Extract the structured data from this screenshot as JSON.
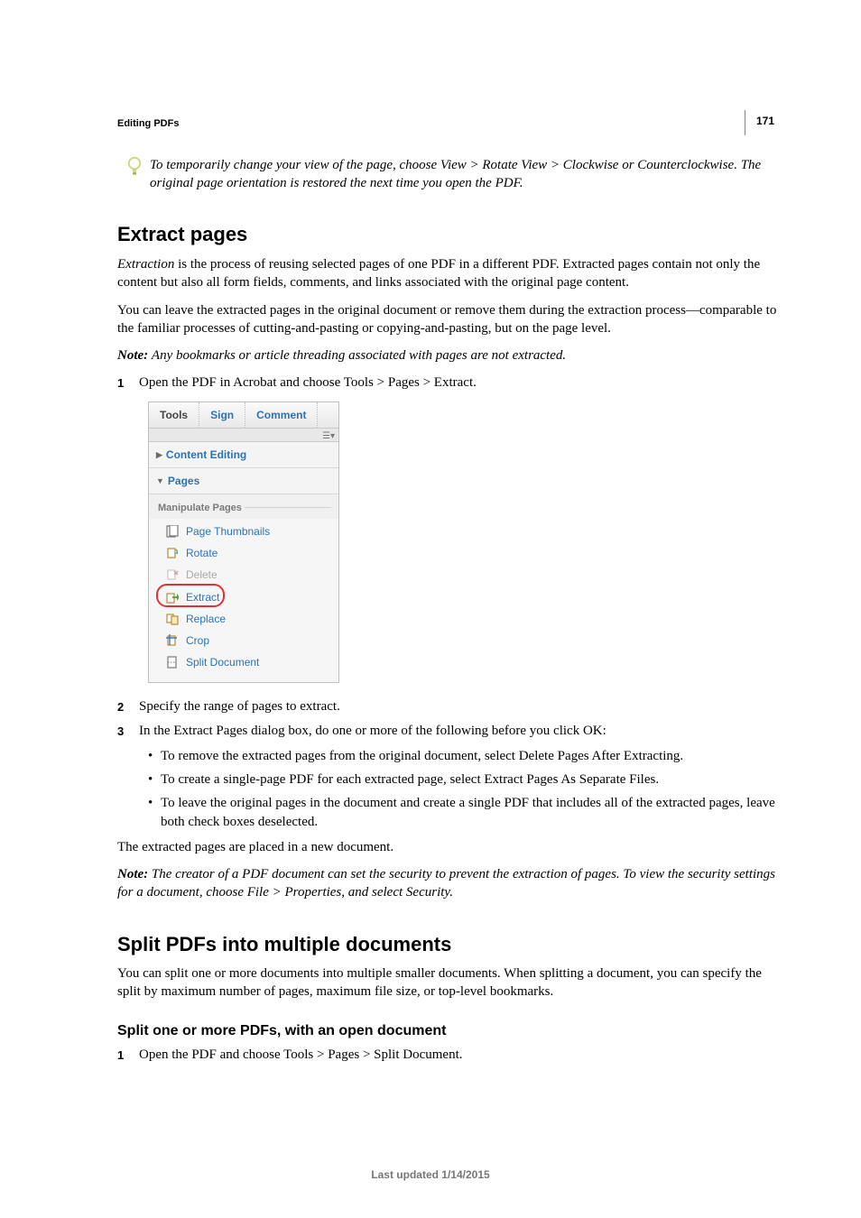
{
  "page_number": "171",
  "section_header": "Editing PDFs",
  "tip": "To temporarily change your view of the page, choose View > Rotate View > Clockwise or Counterclockwise. The original page orientation is restored the next time you open the PDF.",
  "h_extract": "Extract pages",
  "extract_p1_term": "Extraction",
  "extract_p1_rest": " is the process of reusing selected pages of one PDF in a different PDF. Extracted pages contain not only the content but also all form fields, comments, and links associated with the original page content.",
  "extract_p2": "You can leave the extracted pages in the original document or remove them during the extraction process—comparable to the familiar processes of cutting-and-pasting or copying-and-pasting, but on the page level.",
  "note_label": "Note: ",
  "extract_note": "Any bookmarks or article threading associated with pages are not extracted.",
  "step1": "Open the PDF in Acrobat and choose Tools > Pages > Extract.",
  "panel": {
    "tabs": {
      "tools": "Tools",
      "sign": "Sign",
      "comment": "Comment"
    },
    "sections": {
      "content_editing": "Content Editing",
      "pages": "Pages"
    },
    "group_title": "Manipulate Pages",
    "items": {
      "page_thumbnails": "Page Thumbnails",
      "rotate": "Rotate",
      "delete": "Delete",
      "extract": "Extract",
      "replace": "Replace",
      "crop": "Crop",
      "split": "Split Document"
    }
  },
  "step2": "Specify the range of pages to extract.",
  "step3": "In the Extract Pages dialog box, do one or more of the following before you click OK:",
  "bullets": {
    "b1": "To remove the extracted pages from the original document, select Delete Pages After Extracting.",
    "b2": "To create a single-page PDF for each extracted page, select Extract Pages As Separate Files.",
    "b3": "To leave the original pages in the document and create a single PDF that includes all of the extracted pages, leave both check boxes deselected."
  },
  "extract_after": "The extracted pages are placed in a new document.",
  "extract_note2": "The creator of a PDF document can set the security to prevent the extraction of pages. To view the security settings for a document, choose File > Properties, and select Security.",
  "h_split": "Split PDFs into multiple documents",
  "split_p1": "You can split one or more documents into multiple smaller documents. When splitting a document, you can specify the split by maximum number of pages, maximum file size, or top-level bookmarks.",
  "h_split_sub": "Split one or more PDFs, with an open document",
  "split_step1": "Open the PDF and choose Tools > Pages > Split Document.",
  "footer": "Last updated 1/14/2015"
}
